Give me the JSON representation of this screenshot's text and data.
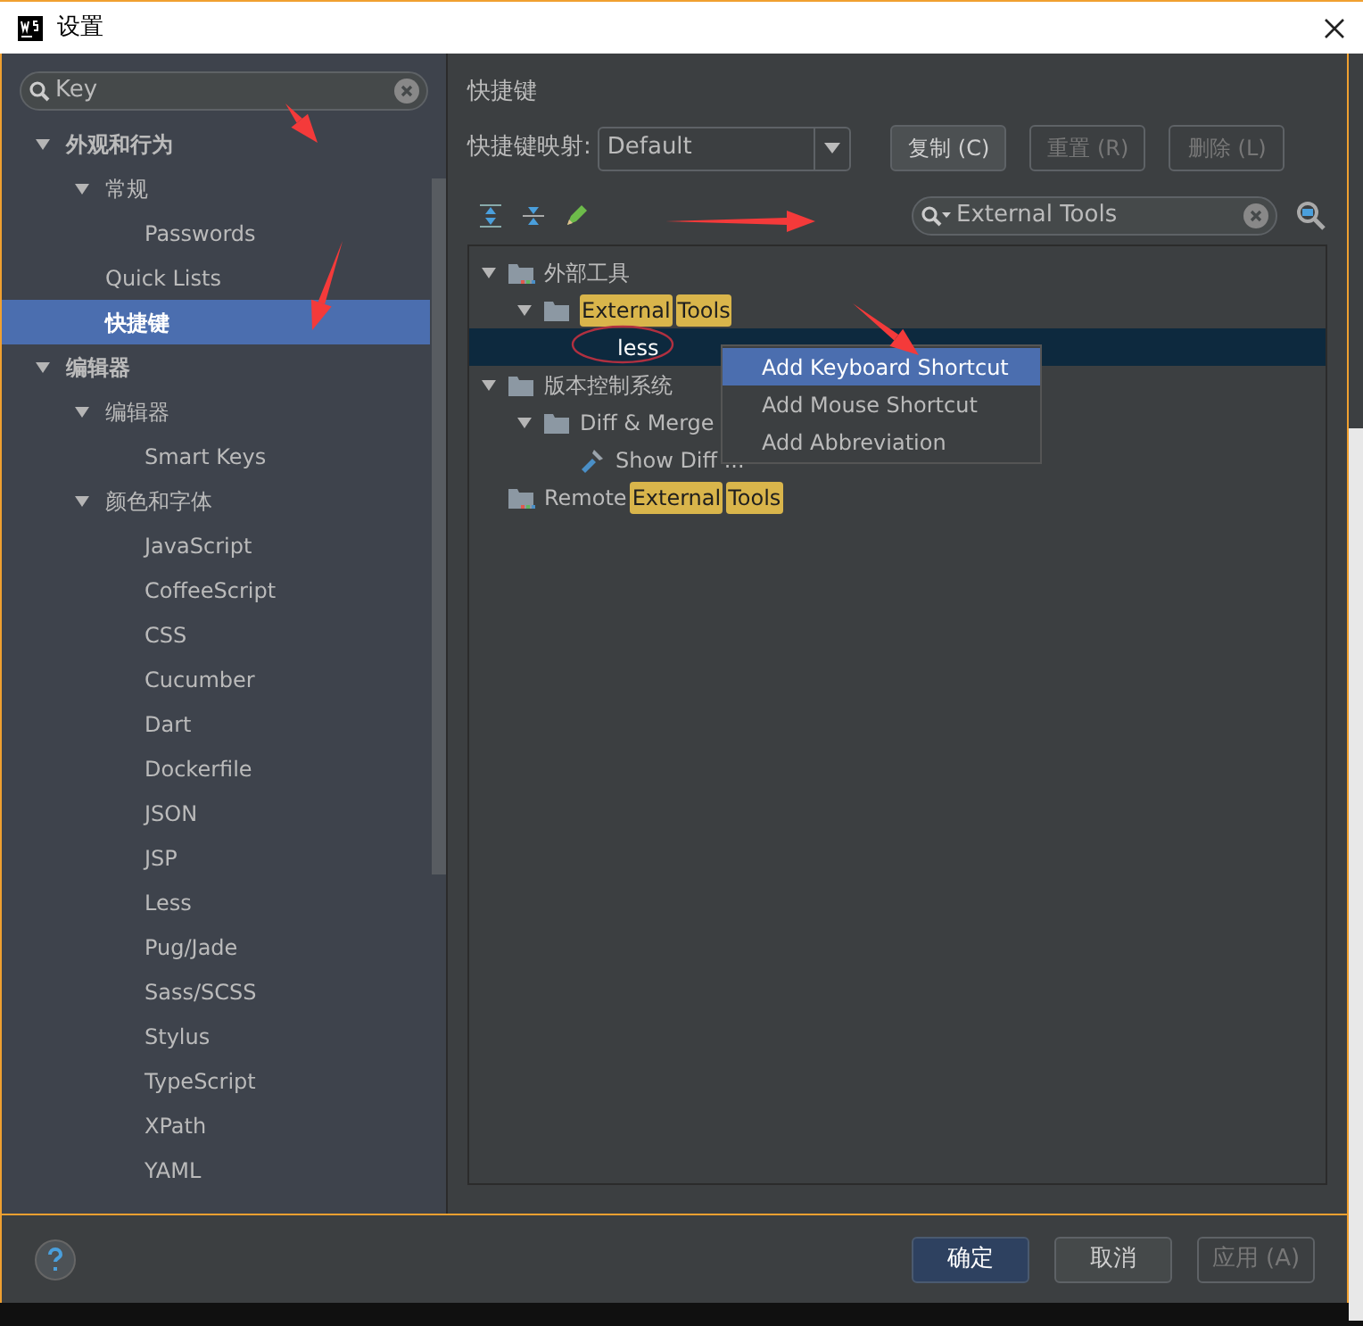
{
  "window": {
    "title": "设置"
  },
  "sidebar": {
    "search": {
      "value": "Key"
    },
    "items": [
      {
        "label": "外观和行为",
        "bold": true,
        "expanded": true,
        "selected": false,
        "children": [
          {
            "label": "常规",
            "bold": false,
            "expanded": true,
            "selected": false,
            "children": [
              {
                "label": "Passwords",
                "bold": false,
                "selected": false
              }
            ]
          },
          {
            "label": "Quick Lists",
            "bold": false,
            "selected": false
          },
          {
            "label": "快捷键",
            "bold": true,
            "selected": true
          }
        ]
      },
      {
        "label": "编辑器",
        "bold": true,
        "expanded": true,
        "selected": false,
        "children": [
          {
            "label": "编辑器",
            "bold": false,
            "expanded": true,
            "selected": false,
            "children": [
              {
                "label": "Smart Keys",
                "bold": false,
                "selected": false
              }
            ]
          },
          {
            "label": "颜色和字体",
            "bold": false,
            "expanded": true,
            "selected": false,
            "children": [
              {
                "label": "JavaScript",
                "bold": false,
                "selected": false
              },
              {
                "label": "CoffeeScript",
                "bold": false,
                "selected": false
              },
              {
                "label": "CSS",
                "bold": false,
                "selected": false
              },
              {
                "label": "Cucumber",
                "bold": false,
                "selected": false
              },
              {
                "label": "Dart",
                "bold": false,
                "selected": false
              },
              {
                "label": "Dockerfile",
                "bold": false,
                "selected": false
              },
              {
                "label": "JSON",
                "bold": false,
                "selected": false
              },
              {
                "label": "JSP",
                "bold": false,
                "selected": false
              },
              {
                "label": "Less",
                "bold": false,
                "selected": false
              },
              {
                "label": "Pug/Jade",
                "bold": false,
                "selected": false
              },
              {
                "label": "Sass/SCSS",
                "bold": false,
                "selected": false
              },
              {
                "label": "Stylus",
                "bold": false,
                "selected": false
              },
              {
                "label": "TypeScript",
                "bold": false,
                "selected": false
              },
              {
                "label": "XPath",
                "bold": false,
                "selected": false
              },
              {
                "label": "YAML",
                "bold": false,
                "selected": false
              }
            ]
          }
        ]
      }
    ]
  },
  "panel": {
    "title": "快捷键",
    "keymap_label": "快捷键映射:",
    "keymap_value": "Default",
    "buttons": [
      {
        "label": "复制 (C)",
        "disabled": false
      },
      {
        "label": "重置 (R)",
        "disabled": true
      },
      {
        "label": "删除 (L)",
        "disabled": true
      }
    ],
    "filter": {
      "value": "External Tools"
    },
    "tree": [
      {
        "kind": "group",
        "parts": [
          {
            "text": "外部工具",
            "highlight": false
          }
        ],
        "expanded": true,
        "selected": false,
        "children": [
          {
            "kind": "folder",
            "parts": [
              {
                "text": "External",
                "highlight": true
              },
              {
                "text": "Tools",
                "highlight": true
              }
            ],
            "expanded": true,
            "selected": false,
            "children": [
              {
                "kind": "action",
                "parts": [
                  {
                    "text": "less",
                    "highlight": false
                  }
                ],
                "selected": true
              }
            ]
          }
        ]
      },
      {
        "kind": "folder",
        "parts": [
          {
            "text": "版本控制系统",
            "highlight": false
          }
        ],
        "expanded": true,
        "selected": false,
        "children": [
          {
            "kind": "folder",
            "parts": [
              {
                "text": "Diff & Merge",
                "highlight": false
              }
            ],
            "expanded": true,
            "selected": false,
            "children": [
              {
                "kind": "tool",
                "parts": [
                  {
                    "text": "Show Diff ...",
                    "highlight": false
                  }
                ],
                "selected": false
              }
            ]
          }
        ]
      },
      {
        "kind": "group",
        "parts": [
          {
            "text": "Remote",
            "highlight": false
          },
          {
            "text": "External",
            "highlight": true
          },
          {
            "text": "Tools",
            "highlight": true
          }
        ],
        "selected": false
      }
    ],
    "context_menu": [
      {
        "label": "Add Keyboard Shortcut",
        "selected": true
      },
      {
        "label": "Add Mouse Shortcut",
        "selected": false
      },
      {
        "label": "Add Abbreviation",
        "selected": false
      }
    ]
  },
  "footer": {
    "buttons": [
      {
        "label": "确定",
        "kind": "primary",
        "disabled": false
      },
      {
        "label": "取消",
        "kind": "normal",
        "disabled": false
      },
      {
        "label": "应用 (A)",
        "kind": "normal",
        "disabled": true
      }
    ]
  }
}
